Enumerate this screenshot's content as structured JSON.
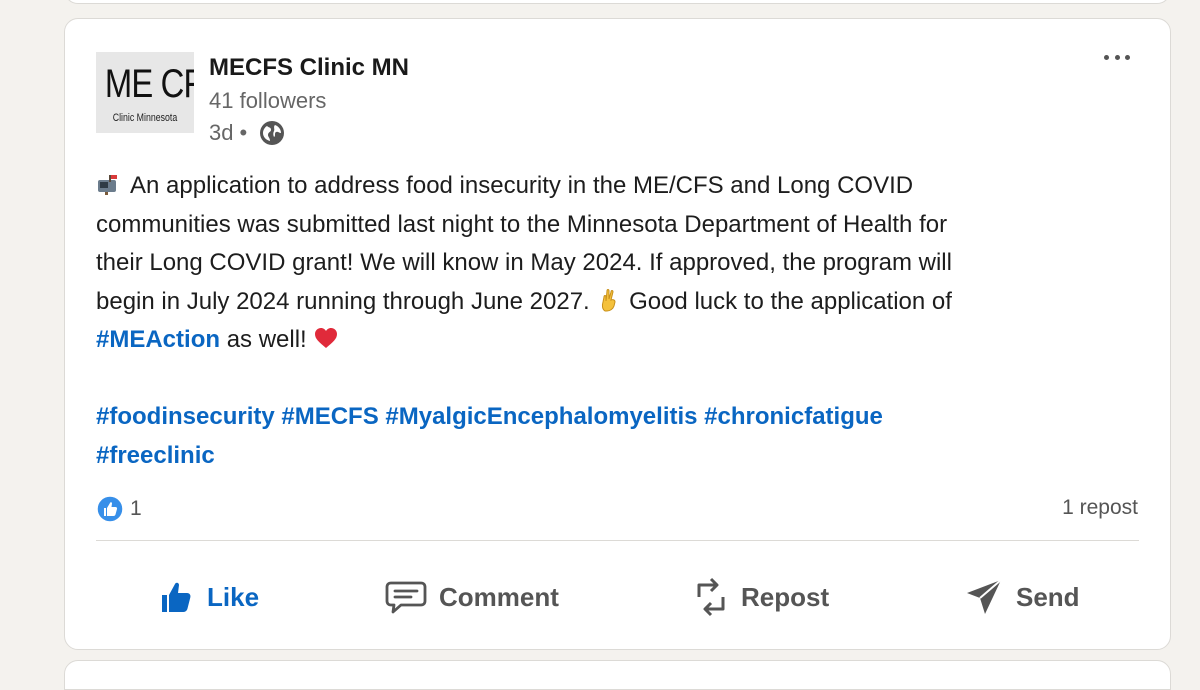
{
  "post": {
    "author": {
      "name": "MECFS Clinic MN",
      "followers": "41 followers",
      "time": "3d",
      "separator": "•",
      "visibility_icon": "globe-icon",
      "logo": {
        "main": "ME CFS",
        "sub": "Clinic Minnesota"
      }
    },
    "more_icon": "more-horizontal-icon",
    "body": {
      "line1": "An application to address food insecurity in the ME/CFS and Long COVID",
      "line2": "communities was submitted last night to the Minnesota Department of Health for",
      "line3": "their Long COVID grant! We will know in May 2024. If approved, the program will",
      "line4a": "begin in July 2024 running through June 2027.",
      "line4b": "Good luck to the application of",
      "mention_tag": "#MEAction",
      "line5_tail": "as well!",
      "hashtags_line1": "#foodinsecurity #MECFS #MyalgicEncephalomyelitis #chronicfatigue",
      "hashtags_line2": "#freeclinic"
    },
    "reactions": {
      "count": "1",
      "icon": "like-reaction-icon"
    },
    "reposts": "1 repost",
    "actions": {
      "like": "Like",
      "comment": "Comment",
      "repost": "Repost",
      "send": "Send"
    },
    "colors": {
      "link": "#0a66c2",
      "text": "#1d1d1d",
      "muted": "#666666",
      "background": "#f4f2ee",
      "card": "#ffffff"
    }
  }
}
